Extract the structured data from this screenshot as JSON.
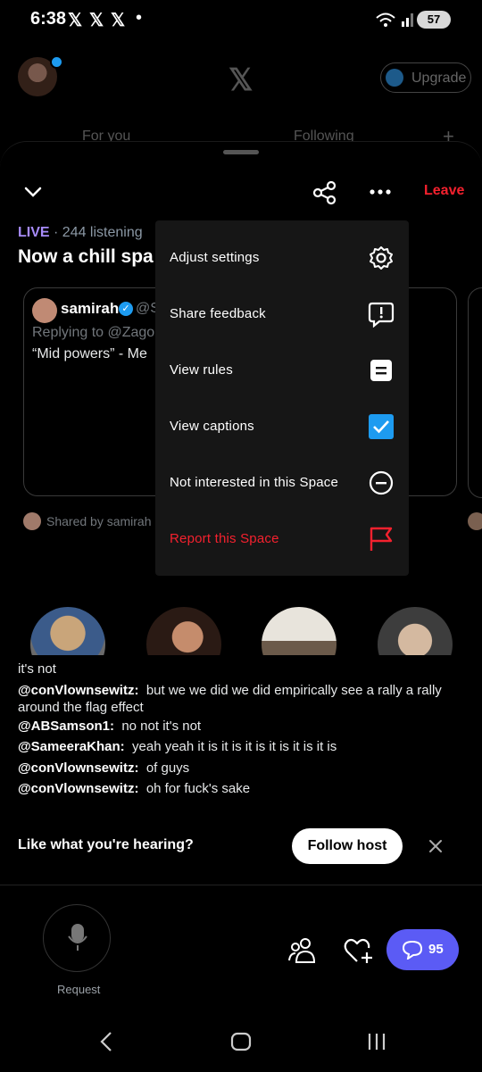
{
  "status_bar": {
    "time": "6:38",
    "apps": [
      "𝕏",
      "𝕏",
      "𝕏"
    ],
    "dot": "•",
    "battery": "57"
  },
  "header": {
    "upgrade_label": "Upgrade",
    "tabs": [
      "For you",
      "Following"
    ],
    "add": "+"
  },
  "space": {
    "leave_label": "Leave",
    "live_label": "LIVE",
    "listening": "· 244 listening",
    "title": "Now a chill spa",
    "card": {
      "name": "samirah",
      "handle": "@S",
      "replying": "Replying to @Zagor",
      "text": "“Mid powers” - Me"
    },
    "shared_by": "Shared by samirah"
  },
  "menu": {
    "items": [
      {
        "label": "Adjust settings",
        "icon": "gear-icon"
      },
      {
        "label": "Share feedback",
        "icon": "feedback-icon"
      },
      {
        "label": "View rules",
        "icon": "rules-icon"
      },
      {
        "label": "View captions",
        "icon": "checkbox-checked-icon"
      },
      {
        "label": "Not interested in this Space",
        "icon": "minus-circle-icon"
      },
      {
        "label": "Report this Space",
        "icon": "flag-icon"
      }
    ]
  },
  "captions": [
    {
      "user": "",
      "text": "it's not"
    },
    {
      "user": "@conVlownsewitz:",
      "text": "but we we did we did empirically see a rally a rally around the flag effect"
    },
    {
      "user": "@ABSamson1:",
      "text": "no not it's not"
    },
    {
      "user": "@SameeraKhan:",
      "text": "yeah yeah it is it is it is it is it is it is"
    },
    {
      "user": "@conVlownsewitz:",
      "text": "of guys"
    },
    {
      "user": "@conVlownsewitz:",
      "text": "oh for fuck's sake"
    }
  ],
  "prompt": {
    "text": "Like what you're hearing?",
    "follow_label": "Follow host"
  },
  "bottom": {
    "request_label": "Request",
    "chat_count": "95"
  },
  "colors": {
    "accent_red": "#f4212e",
    "checkbox_blue": "#1d9bf0",
    "chat_button": "#5b5bf5"
  }
}
